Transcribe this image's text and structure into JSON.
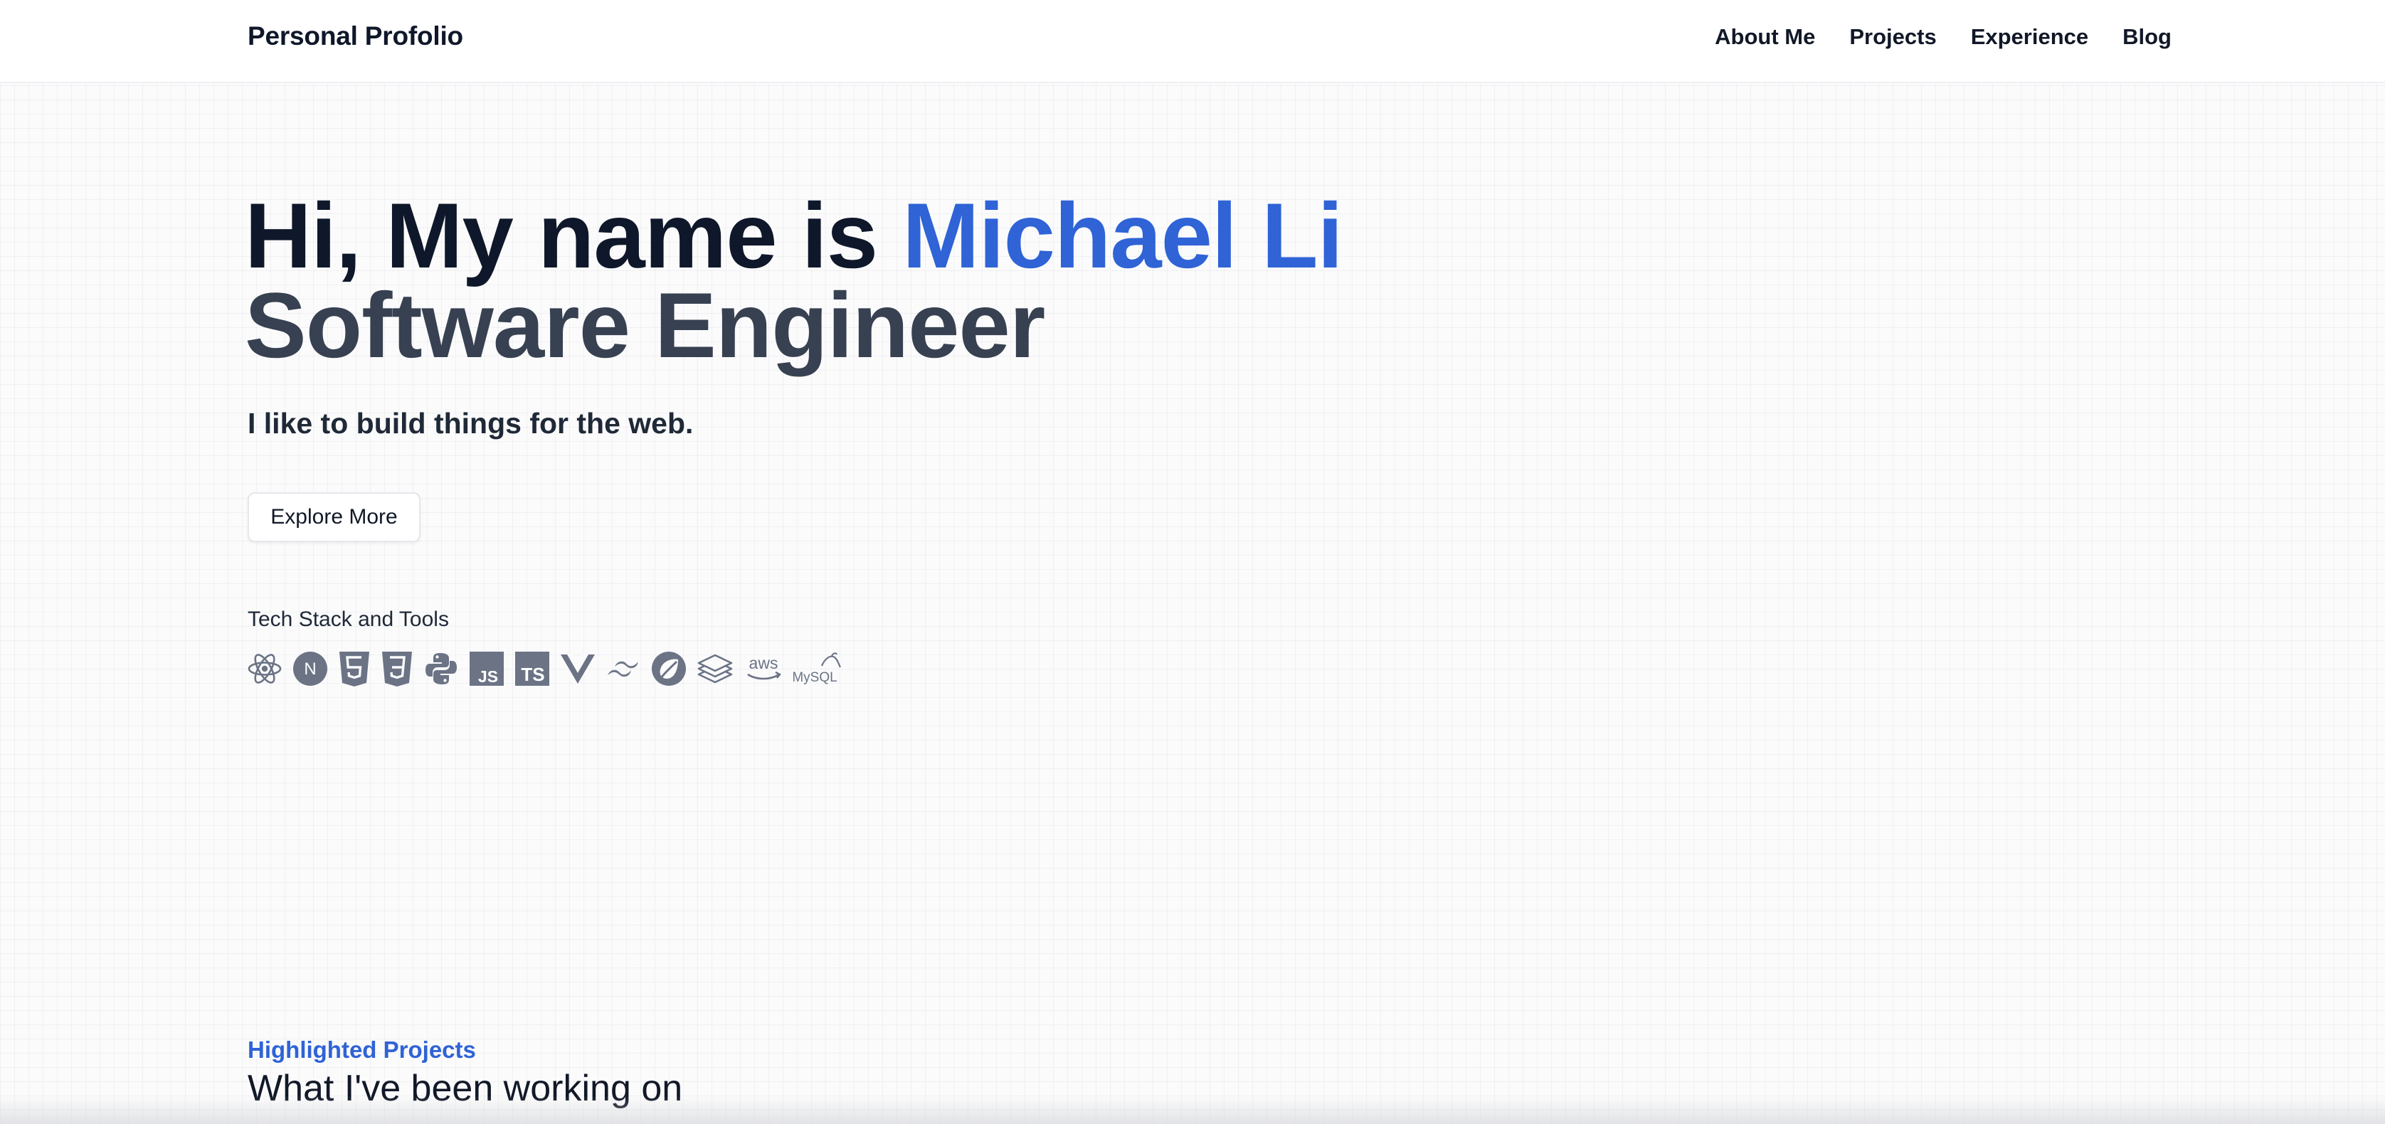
{
  "header": {
    "brand": "Personal Profolio",
    "nav": [
      "About Me",
      "Projects",
      "Experience",
      "Blog"
    ]
  },
  "hero": {
    "greeting": "Hi, My name is ",
    "name": "Michael Li",
    "role": "Software Engineer",
    "tagline": "I like to build things for the web.",
    "cta_label": "Explore More"
  },
  "tech_stack": {
    "label": "Tech Stack and Tools",
    "icons": [
      "react-icon",
      "nextjs-icon",
      "html5-icon",
      "css3-icon",
      "python-icon",
      "javascript-icon",
      "typescript-icon",
      "vue-icon",
      "tailwind-icon",
      "spring-icon",
      "stack-layers-icon",
      "aws-icon",
      "mysql-icon"
    ],
    "icon_texts": {
      "nextjs": "N",
      "javascript": "JS",
      "typescript": "TS",
      "aws": "aws",
      "mysql": "MySQL"
    }
  },
  "projects_section": {
    "kicker": "Highlighted Projects",
    "title": "What I've been working on"
  },
  "colors": {
    "accent": "#2f63d6",
    "heading": "#0f172a",
    "subheading": "#374151",
    "icon": "#6b7385"
  }
}
